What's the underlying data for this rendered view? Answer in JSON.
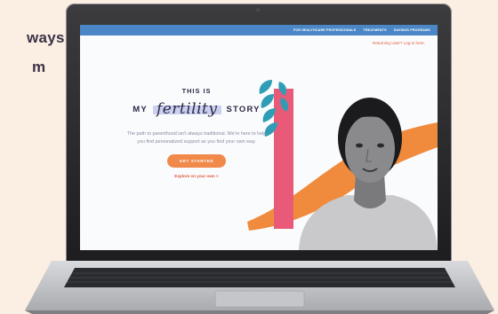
{
  "background_text": [
    "ways",
    "m"
  ],
  "nav": {
    "links": [
      "FOR HEALTHCARE PROFESSIONALS",
      "TREATMENTS",
      "SAVINGS PROGRAMS"
    ],
    "login": "Returning User? Log in here."
  },
  "hero": {
    "eyebrow": "THIS IS",
    "title_prefix": "MY",
    "title_script": "fertility",
    "title_suffix": "STORY",
    "description_line1": "The path to parenthood isn't always traditional. We're here to help",
    "description_line2": "you find personalized support as you find your own way.",
    "cta": "GET STARTED",
    "explore": "Explore on your own >"
  },
  "colors": {
    "accent_blue": "#4b87c6",
    "cta_orange": "#f0894a",
    "link_red": "#e05a3a",
    "art_pink": "#e85a78",
    "art_teal": "#2f9db5",
    "art_orange": "#f08a3c"
  }
}
